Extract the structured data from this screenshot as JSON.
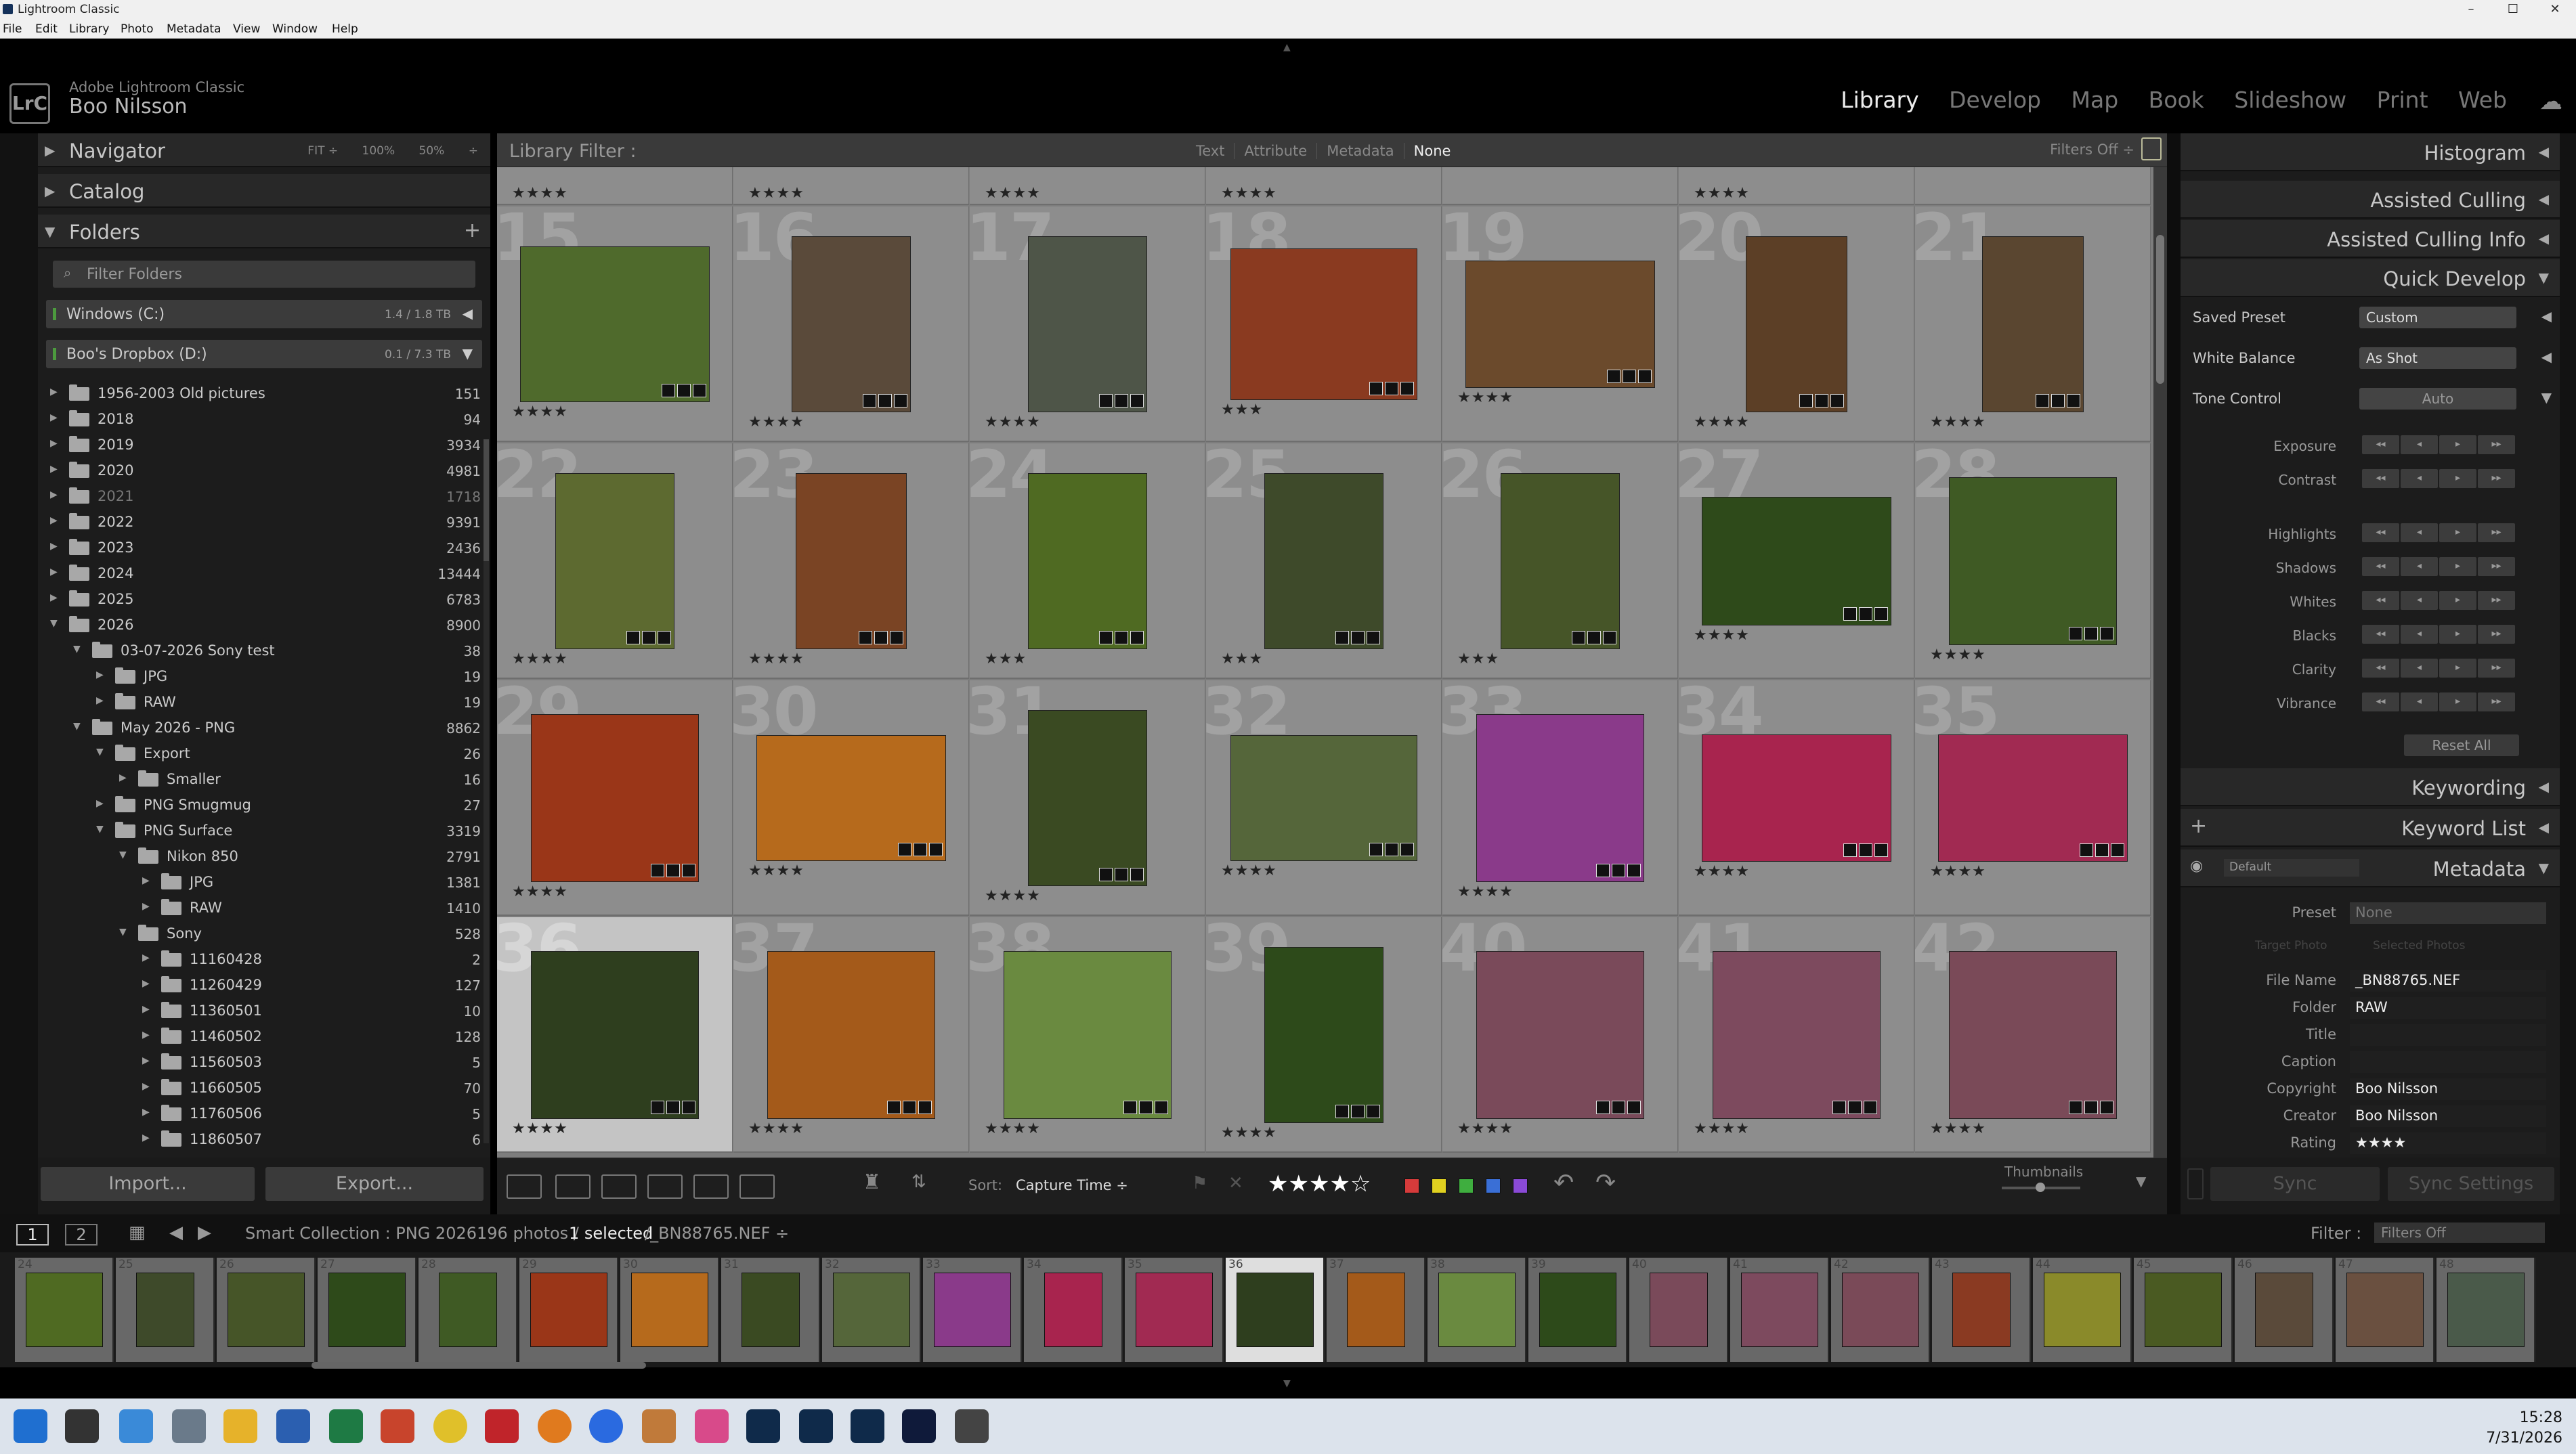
{
  "window": {
    "title": "Lightroom Classic",
    "buttons": [
      "–",
      "☐",
      "✕"
    ]
  },
  "menu": [
    "File",
    "Edit",
    "Library",
    "Photo",
    "Metadata",
    "View",
    "Window",
    "Help"
  ],
  "identity": {
    "logo": "LrC",
    "product": "Adobe Lightroom Classic",
    "user": "Boo Nilsson"
  },
  "modules": [
    "Library",
    "Develop",
    "Map",
    "Book",
    "Slideshow",
    "Print",
    "Web"
  ],
  "active_module": "Library",
  "left_panel": {
    "navigator": {
      "label": "Navigator",
      "zoom_options": [
        "FIT ÷",
        "100%",
        "50%",
        "÷"
      ]
    },
    "catalog": {
      "label": "Catalog"
    },
    "folders": {
      "label": "Folders",
      "add": "+",
      "filter_placeholder": "Filter Folders"
    },
    "volumes": [
      {
        "name": "Windows (C:)",
        "size": "1.4 / 1.8 TB",
        "arrow": "◀"
      },
      {
        "name": "Boo's Dropbox (D:)",
        "size": "0.1 / 7.3 TB",
        "arrow": "▼"
      }
    ],
    "tree": [
      {
        "name": "1956-2003 Old pictures",
        "count": "151",
        "depth": 0,
        "open": false
      },
      {
        "name": "2018",
        "count": "94",
        "depth": 0,
        "open": false
      },
      {
        "name": "2019",
        "count": "3934",
        "depth": 0,
        "open": false
      },
      {
        "name": "2020",
        "count": "4981",
        "depth": 0,
        "open": false
      },
      {
        "name": "2021",
        "count": "1718",
        "depth": 0,
        "open": false,
        "dim": true
      },
      {
        "name": "2022",
        "count": "9391",
        "depth": 0,
        "open": false
      },
      {
        "name": "2023",
        "count": "2436",
        "depth": 0,
        "open": false
      },
      {
        "name": "2024",
        "count": "13444",
        "depth": 0,
        "open": false
      },
      {
        "name": "2025",
        "count": "6783",
        "depth": 0,
        "open": false
      },
      {
        "name": "2026",
        "count": "8900",
        "depth": 0,
        "open": true
      },
      {
        "name": "03-07-2026 Sony test",
        "count": "38",
        "depth": 1,
        "open": true
      },
      {
        "name": "JPG",
        "count": "19",
        "depth": 2,
        "open": false
      },
      {
        "name": "RAW",
        "count": "19",
        "depth": 2,
        "open": false
      },
      {
        "name": "May 2026 - PNG",
        "count": "8862",
        "depth": 1,
        "open": true
      },
      {
        "name": "Export",
        "count": "26",
        "depth": 2,
        "open": true
      },
      {
        "name": "Smaller",
        "count": "16",
        "depth": 3,
        "open": false
      },
      {
        "name": "PNG Smugmug",
        "count": "27",
        "depth": 2,
        "open": false
      },
      {
        "name": "PNG Surface",
        "count": "3319",
        "depth": 2,
        "open": true
      },
      {
        "name": "Nikon 850",
        "count": "2791",
        "depth": 3,
        "open": true
      },
      {
        "name": "JPG",
        "count": "1381",
        "depth": 4,
        "open": false
      },
      {
        "name": "RAW",
        "count": "1410",
        "depth": 4,
        "open": false
      },
      {
        "name": "Sony",
        "count": "528",
        "depth": 3,
        "open": true
      },
      {
        "name": "11160428",
        "count": "2",
        "depth": 4,
        "open": false
      },
      {
        "name": "11260429",
        "count": "127",
        "depth": 4,
        "open": false
      },
      {
        "name": "11360501",
        "count": "10",
        "depth": 4,
        "open": false
      },
      {
        "name": "11460502",
        "count": "128",
        "depth": 4,
        "open": false
      },
      {
        "name": "11560503",
        "count": "5",
        "depth": 4,
        "open": false
      },
      {
        "name": "11660505",
        "count": "70",
        "depth": 4,
        "open": false
      },
      {
        "name": "11760506",
        "count": "5",
        "depth": 4,
        "open": false
      },
      {
        "name": "11860507",
        "count": "6",
        "depth": 4,
        "open": false
      }
    ],
    "import_label": "Import...",
    "export_label": "Export..."
  },
  "library_filter": {
    "label": "Library Filter :",
    "options": [
      "Text",
      "Attribute",
      "Metadata",
      "None"
    ],
    "selected": "None",
    "status": "Filters Off ÷"
  },
  "grid": {
    "top_row_stars": [
      "★★★★",
      "★★★★",
      "★★★★",
      "★★★★",
      "",
      "★★★★",
      ""
    ],
    "cells": [
      {
        "num": "15",
        "stars": "★★★★",
        "color": "#4f6a2c"
      },
      {
        "num": "16",
        "stars": "★★★★",
        "color": "#5a4a3a"
      },
      {
        "num": "17",
        "stars": "★★★★",
        "color": "#4e5548"
      },
      {
        "num": "18",
        "stars": "★★★",
        "color": "#8a3a20"
      },
      {
        "num": "19",
        "stars": "★★★★",
        "color": "#6b4a2c"
      },
      {
        "num": "20",
        "stars": "★★★★",
        "color": "#5c3f26"
      },
      {
        "num": "21",
        "stars": "★★★★",
        "color": "#5a4630"
      },
      {
        "num": "22",
        "stars": "★★★★",
        "color": "#5d6a30"
      },
      {
        "num": "23",
        "stars": "★★★★",
        "color": "#7a4424"
      },
      {
        "num": "24",
        "stars": "★★★",
        "color": "#4f6a22"
      },
      {
        "num": "25",
        "stars": "★★★",
        "color": "#3e4a2a"
      },
      {
        "num": "26",
        "stars": "★★★",
        "color": "#465528"
      },
      {
        "num": "27",
        "stars": "★★★★",
        "color": "#2e4a1a"
      },
      {
        "num": "28",
        "stars": "★★★★",
        "color": "#3f5a24"
      },
      {
        "num": "29",
        "stars": "★★★★",
        "color": "#9a3618"
      },
      {
        "num": "30",
        "stars": "★★★★",
        "color": "#b66a1c"
      },
      {
        "num": "31",
        "stars": "★★★★",
        "color": "#3a4a22"
      },
      {
        "num": "32",
        "stars": "★★★★",
        "color": "#55663a"
      },
      {
        "num": "33",
        "stars": "★★★★",
        "color": "#8a3a8a"
      },
      {
        "num": "34",
        "stars": "★★★★",
        "color": "#a8244e"
      },
      {
        "num": "35",
        "stars": "★★★★",
        "color": "#a12a52"
      },
      {
        "num": "36",
        "stars": "★★★★",
        "color": "#2e3e1e",
        "selected": true
      },
      {
        "num": "37",
        "stars": "★★★★",
        "color": "#a45a1a"
      },
      {
        "num": "38",
        "stars": "★★★★",
        "color": "#6a8a40"
      },
      {
        "num": "39",
        "stars": "★★★★",
        "color": "#2d4a1a"
      },
      {
        "num": "40",
        "stars": "★★★★",
        "color": "#7a4a5a"
      },
      {
        "num": "41",
        "stars": "★★★★",
        "color": "#7d4a5e"
      },
      {
        "num": "42",
        "stars": "★★★★",
        "color": "#7a4a58"
      }
    ]
  },
  "toolbar": {
    "sort_label": "Sort:",
    "sort_value": "Capture Time ÷",
    "rating": "★★★★☆",
    "colors": [
      "#d63b3b",
      "#e0d020",
      "#3fae3f",
      "#3a6fd6",
      "#8a4ad6"
    ],
    "thumbnails_label": "Thumbnails"
  },
  "right_panel": {
    "sections": [
      "Histogram",
      "Assisted Culling",
      "Assisted Culling Info",
      "Quick Develop"
    ],
    "saved_preset": {
      "label": "Saved Preset",
      "value": "Custom"
    },
    "white_balance": {
      "label": "White Balance",
      "value": "As Shot"
    },
    "tone_control": {
      "label": "Tone Control",
      "value": "Auto"
    },
    "tone_adjust": [
      "Exposure",
      "Contrast"
    ],
    "tone_adjust2": [
      "Highlights",
      "Shadows",
      "Whites",
      "Blacks"
    ],
    "presence_adjust": [
      "Clarity",
      "Vibrance"
    ],
    "reset_label": "Reset All",
    "keywording": "Keywording",
    "keyword_list": "Keyword List",
    "metadata": {
      "label": "Metadata",
      "set": "Default",
      "preset_label": "Preset",
      "preset_value": "None",
      "target_tabs": [
        "Target Photo",
        "Selected Photos"
      ],
      "fields": [
        {
          "k": "File Name",
          "v": "_BN88765.NEF"
        },
        {
          "k": "Folder",
          "v": "RAW"
        },
        {
          "k": "Title",
          "v": ""
        },
        {
          "k": "Caption",
          "v": ""
        },
        {
          "k": "Copyright",
          "v": "Boo Nilsson"
        },
        {
          "k": "Creator",
          "v": "Boo Nilsson"
        },
        {
          "k": "Rating",
          "v": "★★★★"
        }
      ]
    },
    "sync_label": "Sync",
    "sync_settings_label": "Sync Settings"
  },
  "filmstrip_header": {
    "screen1": "1",
    "screen2": "2",
    "source_prefix": "Smart Collection : PNG 2026",
    "photos_count": "196 photos /",
    "selected": "1 selected",
    "filename": "/_BN88765.NEF ÷",
    "filter_label": "Filter :",
    "filter_value": "Filters Off"
  },
  "filmstrip": [
    {
      "n": "24",
      "c": "#4f6a22"
    },
    {
      "n": "25",
      "c": "#3e4a2a"
    },
    {
      "n": "26",
      "c": "#465528"
    },
    {
      "n": "27",
      "c": "#2e4a1a"
    },
    {
      "n": "28",
      "c": "#3f5a24"
    },
    {
      "n": "29",
      "c": "#9a3618"
    },
    {
      "n": "30",
      "c": "#b66a1c"
    },
    {
      "n": "31",
      "c": "#3a4a22"
    },
    {
      "n": "32",
      "c": "#55663a"
    },
    {
      "n": "33",
      "c": "#8a3a8a"
    },
    {
      "n": "34",
      "c": "#a8244e"
    },
    {
      "n": "35",
      "c": "#a12a52"
    },
    {
      "n": "36",
      "c": "#d8d8d0",
      "selected": true
    },
    {
      "n": "37",
      "c": "#a45a1a"
    },
    {
      "n": "38",
      "c": "#6a8a40"
    },
    {
      "n": "39",
      "c": "#2d4a1a"
    },
    {
      "n": "40",
      "c": "#7a4a5a"
    },
    {
      "n": "41",
      "c": "#7d4a5e"
    },
    {
      "n": "42",
      "c": "#7a4a58"
    },
    {
      "n": "43",
      "c": "#8a3a22"
    },
    {
      "n": "44",
      "c": "#8a8a2a"
    },
    {
      "n": "45",
      "c": "#4a5a22"
    },
    {
      "n": "46",
      "c": "#5a4a3a"
    },
    {
      "n": "47",
      "c": "#6a5040"
    },
    {
      "n": "48",
      "c": "#4a5a4a"
    }
  ],
  "taskbar": {
    "time": "15:28",
    "date": "7/31/2026"
  }
}
